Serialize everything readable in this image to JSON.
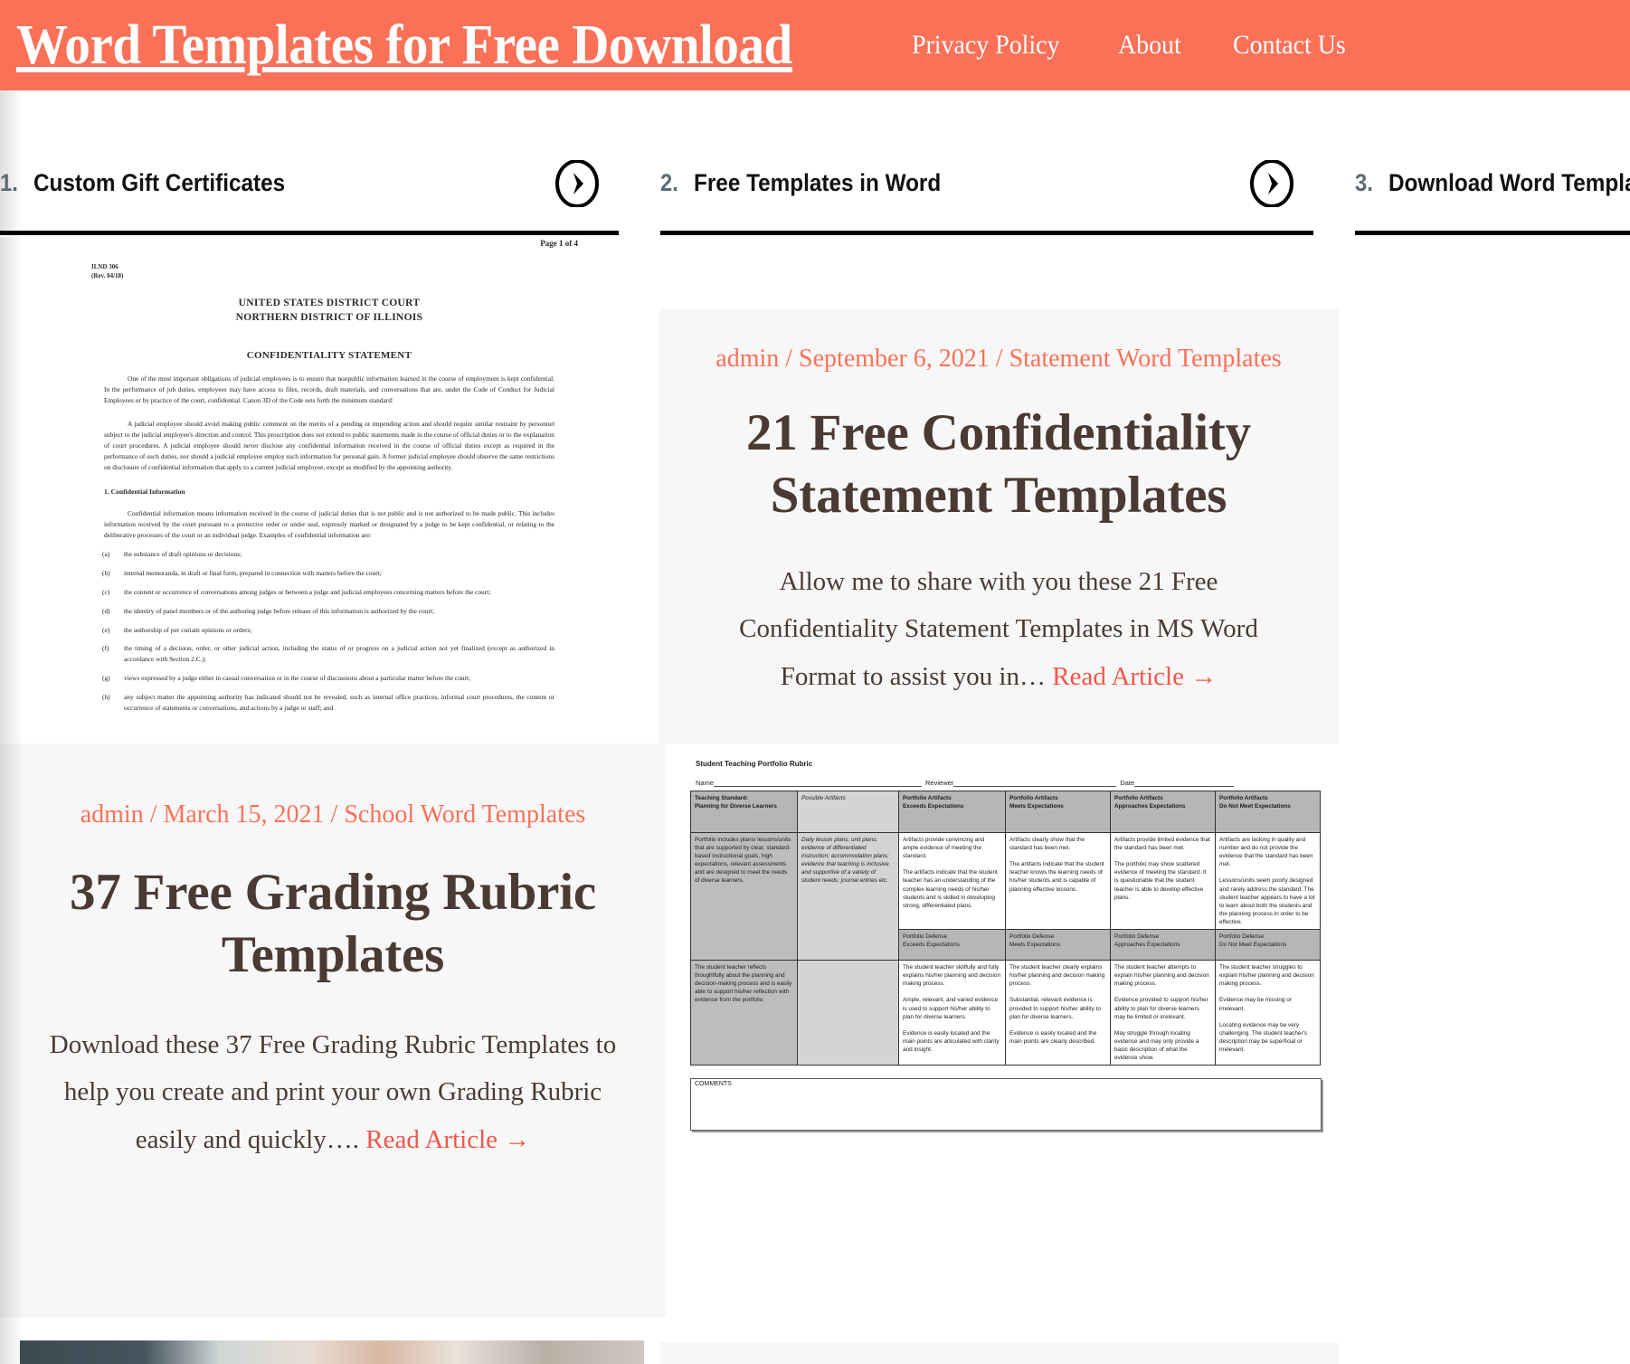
{
  "header": {
    "site_title": "Word Templates for Free Download",
    "brand_color": "#fa7158",
    "nav": [
      {
        "label": "Privacy Policy"
      },
      {
        "label": "About"
      },
      {
        "label": "Contact Us"
      }
    ]
  },
  "sitelinks": [
    {
      "number": "1.",
      "label": "Custom Gift Certificates",
      "arrow_icon": "chevron-right-circle-icon"
    },
    {
      "number": "2.",
      "label": "Free Templates in Word",
      "arrow_icon": "chevron-right-circle-icon"
    },
    {
      "number": "3.",
      "label": "Download Word Templates",
      "arrow_icon": "chevron-right-circle-icon"
    }
  ],
  "posts": [
    {
      "author": "admin",
      "date": "September 6, 2021",
      "category": "Statement Word Templates",
      "meta_line": "admin / September 6, 2021 / Statement Word Templates",
      "title": "21 Free Confidentiality Statement Templates",
      "excerpt": "Allow me to share with you these 21 Free Confidentiality Statement Templates in MS Word Format to assist you in… ",
      "read_more": "Read Article →"
    },
    {
      "author": "admin",
      "date": "March 15, 2021",
      "category": "School Word Templates",
      "meta_line": "admin / March 15, 2021 / School Word Templates",
      "title": "37 Free Grading Rubric Templates",
      "excerpt": "Download these 37 Free Grading Rubric Templates to help you create and print your own Grading Rubric easily and quickly…. ",
      "read_more": "Read Article →"
    }
  ],
  "thumbnail_confidentiality": {
    "page_number": "Page 1 of 4",
    "form_number": "ILND 306",
    "form_revision": "(Rev. 04/18)",
    "court_line1": "UNITED STATES DISTRICT COURT",
    "court_line2": "NORTHERN DISTRICT OF ILLINOIS",
    "heading": "CONFIDENTIALITY STATEMENT",
    "para1": "One of the most important obligations of judicial employees is to ensure that nonpublic information learned in the course of employment is kept confidential. In the performance of job duties, employees may have access to files, records, draft materials, and conversations that are, under the Code of Conduct for Judicial Employees or by practice of the court, confidential. Canon 3D of the Code sets forth the minimum standard:",
    "para2": "A judicial employee should avoid making public comment on the merits of a pending or impending action and should require similar restraint by personnel subject to the judicial employee's direction and control. This proscription does not extend to public statements made in the course of official duties or to the explanation of court procedures. A judicial employee should never disclose any confidential information received in the course of official duties except as required in the performance of such duties, nor should a judicial employee employ such information for personal gain. A former judicial employee should observe the same restrictions on disclosure of confidential information that apply to a current judicial employee, except as modified by the appointing authority.",
    "section1_title": "1. Confidential Information",
    "para3": "Confidential information means information received in the course of judicial duties that is not public and is not authorized to be made public. This includes information received by the court pursuant to a protective order or under seal, expressly marked or designated by a judge to be kept confidential, or relating to the deliberative processes of the court or an individual judge. Examples of confidential information are:",
    "items": [
      {
        "marker": "(a)",
        "text": "the substance of draft opinions or decisions;"
      },
      {
        "marker": "(b)",
        "text": "internal memoranda, in draft or final form, prepared in connection with matters before the court;"
      },
      {
        "marker": "(c)",
        "text": "the content or occurrence of conversations among judges or between a judge and judicial employees concerning matters before the court;"
      },
      {
        "marker": "(d)",
        "text": "the identity of panel members or of the authoring judge before release of this information is authorized by the court;"
      },
      {
        "marker": "(e)",
        "text": "the authorship of per curiam opinions or orders;"
      },
      {
        "marker": "(f)",
        "text": "the timing of a decision, order, or other judicial action, including the status of or progress on a judicial action not yet finalized (except as authorized in accordance with Section 2.C.);"
      },
      {
        "marker": "(g)",
        "text": "views expressed by a judge either in casual conversation or in the course of discussions about a particular matter before the court;"
      },
      {
        "marker": "(h)",
        "text": "any subject matter the appointing authority has indicated should not be revealed, such as internal office practices, informal court procedures, the content or occurrence of statements or conversations, and actions by a judge or staff; and"
      }
    ]
  },
  "thumbnail_rubric": {
    "title": "Student Teaching Portfolio Rubric",
    "fields": [
      "Name",
      "Reviewer",
      "Date"
    ],
    "comments_label": "COMMENTS",
    "header_row": [
      "Teaching Standard:\nPlanning for Diverse Learners",
      "Possible Artifacts",
      "Portfolio Artifacts\nExceeds Expectations",
      "Portfolio Artifacts\nMeets Expectations",
      "Portfolio Artifacts\nApproaches Expectations",
      "Portfolio Artifacts\nDo Not Meet Expectations"
    ],
    "row2": [
      "Portfolio includes plans/ lessons/units that are supported by clear, standard-based instructional goals, high expectations, relevant assessments and are designed to meet the needs of diverse learners.",
      "Daily lesson plans; unit plans; evidence of differentiated instruction; accommodation plans; evidence that teaching is inclusive and supportive of a variety of student needs; journal entries etc.",
      "Artifacts provide convincing and ample evidence of meeting the standard.\n\nThe artifacts indicate that the student teacher has an understanding of the complex learning needs of his/her students and is skilled in developing strong, differentiated plans.",
      "Artifacts clearly show that the standard has been met.\n\nThe artifacts indicate that the student teacher knows the learning needs of his/her students and is capable of planning effective lessons.",
      "Artifacts provide limited evidence that the standard has been met.\n\nThe portfolio may show scattered evidence of meeting the standard. It is questionable that the student teacher is able to develop effective plans.",
      "Artifacts are lacking in quality and number and do not provide the evidence that the standard has been met.\n\nLessons/units seem poorly designed and rarely address the standard. The student teacher appears to have a lot to learn about both the students and the planning process in order to be effective."
    ],
    "row3_sub": [
      "Portfolio Defense\nExceeds Expectations",
      "Portfolio Defense\nMeets Expectations",
      "Portfolio Defense\nApproaches Expectations",
      "Portfolio Defense\nDo Not Meet Expectations"
    ],
    "row4_first": "The student teacher reflects thoughtfully about the planning and decision-making process and is easily able to support his/her reflection with evidence from the portfolio",
    "row4": [
      "The student teacher skillfully and fully explains his/her planning and decision making process.\n\nAmple, relevant, and varied evidence is used to support his/her ability to plan for diverse learners.\n\nEvidence is easily located and the main points are articulated with clarity and insight.",
      "The student teacher clearly explains his/her planning and decision making process.\n\nSubstantial, relevant evidence is provided to support his/her ability to plan for diverse learners.\n\nEvidence is easily located and the main points are clearly described.",
      "The student teacher attempts to explain his/her planning and decision making process.\n\nEvidence provided to support his/her ability to plan for diverse learners may be limited or irrelevant.\n\nMay struggle through locating evidence and may only provide a basic description of what the evidence show.",
      "The student teacher struggles to explain his/her planning and decision making process.\n\nEvidence may be missing or irrelevant.\n\nLocating evidence may be very challenging. The student teacher's description may be superficial or irrelevant."
    ]
  }
}
